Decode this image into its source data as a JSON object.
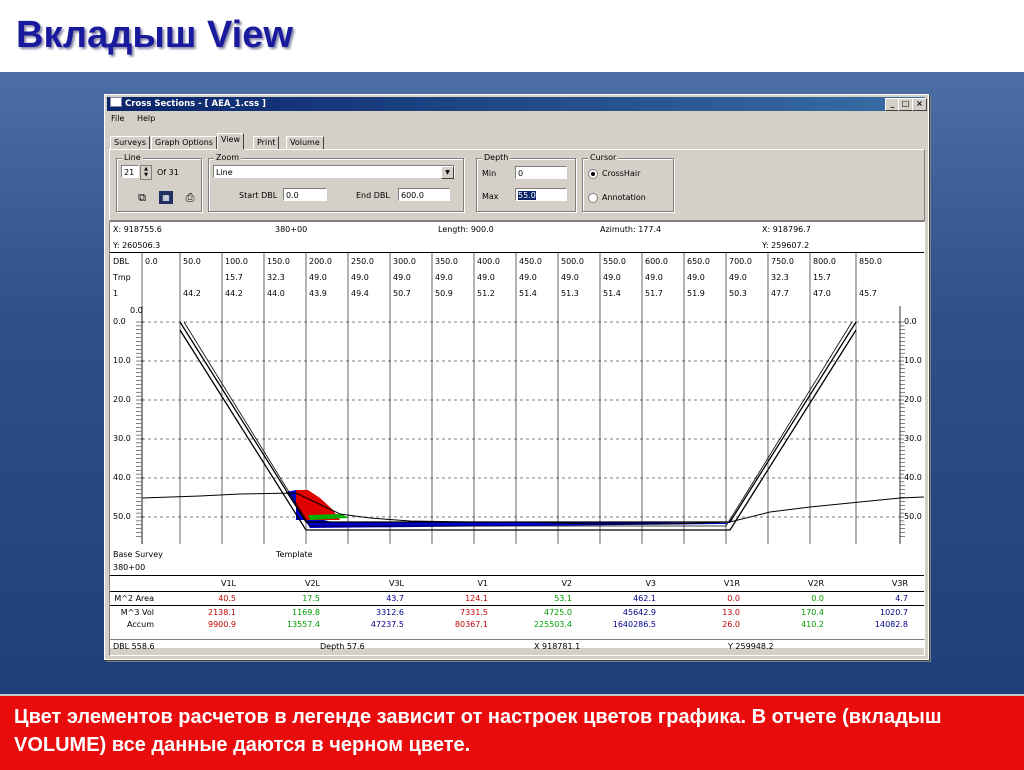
{
  "slide": {
    "title": "Вкладыш View",
    "caption": "Цвет элементов расчетов в легенде зависит от настроек цветов графика.  В отчете (вкладыш VOLUME) все данные даются в черном цвете."
  },
  "window": {
    "title": "Cross  Sections - [ AEA_1.css ]",
    "buttons": {
      "minimize": "_",
      "restore": "□",
      "close": "×"
    },
    "menu": [
      "File",
      "Help"
    ],
    "tabs": [
      "Surveys",
      "Graph Options",
      "View",
      "Print",
      "Volume"
    ],
    "active_tab": "View"
  },
  "controls": {
    "line": {
      "label": "Line",
      "value": "21",
      "of": "Of  31"
    },
    "zoom": {
      "label": "Zoom",
      "mode": "Line",
      "start_label": "Start DBL",
      "start_value": "0.0",
      "end_label": "End DBL",
      "end_value": "600.0"
    },
    "depth": {
      "label": "Depth",
      "min_label": "Min",
      "min_value": "0",
      "max_label": "Max",
      "max_value": "55.0"
    },
    "cursor": {
      "label": "Cursor",
      "options": [
        "CrossHair",
        "Annotation"
      ],
      "selected": "CrossHair"
    }
  },
  "plot": {
    "info": {
      "x_left": "X: 918755.6",
      "station": "380+00",
      "length": "Length: 900.0",
      "azimuth": "Azimuth: 177.4",
      "x_right": "X: 918796.7",
      "y_left": "Y: 260506.3",
      "y_right": "Y: 259607.2"
    },
    "row_labels": [
      "DBL",
      "Tmp",
      "1"
    ],
    "dbl": [
      "0.0",
      "50.0",
      "100.0",
      "150.0",
      "200.0",
      "250.0",
      "300.0",
      "350.0",
      "400.0",
      "450.0",
      "500.0",
      "550.0",
      "600.0",
      "650.0",
      "700.0",
      "750.0",
      "800.0",
      "850.0"
    ],
    "tmp": [
      "",
      "",
      "15.7",
      "32.3",
      "49.0",
      "49.0",
      "49.0",
      "49.0",
      "49.0",
      "49.0",
      "49.0",
      "49.0",
      "49.0",
      "49.0",
      "49.0",
      "32.3",
      "15.7",
      ""
    ],
    "survey": [
      "",
      "44.2",
      "44.2",
      "44.0",
      "43.9",
      "49.4",
      "50.7",
      "50.9",
      "51.2",
      "51.4",
      "51.3",
      "51.4",
      "51.7",
      "51.9",
      "50.3",
      "47.7",
      "47.0",
      "45.7"
    ],
    "origin_label": "0.0",
    "depth_ticks": [
      "0.0",
      "10.0",
      "20.0",
      "30.0",
      "40.0",
      "50.0"
    ],
    "base_survey_label": "Base Survey",
    "template_label": "Template",
    "station": "380+00"
  },
  "legend": {
    "headers": [
      "V1L",
      "V2L",
      "V3L",
      "V1",
      "V2",
      "V3",
      "V1R",
      "V2R",
      "V3R"
    ],
    "rows": [
      {
        "label": "M^2 Area",
        "values": [
          "40.5",
          "17.5",
          "43.7",
          "124.1",
          "53.1",
          "462.1",
          "0.0",
          "0.0",
          "4.7"
        ]
      },
      {
        "label": "M^3 Vol",
        "values": [
          "2138.1",
          "1169.8",
          "3312.6",
          "7331.5",
          "4725.0",
          "45642.9",
          "13.0",
          "170.4",
          "1020.7"
        ]
      },
      {
        "label": "Accum",
        "values": [
          "9900.9",
          "13557.4",
          "47237.5",
          "80367.1",
          "225503.4",
          "1640286.5",
          "26.0",
          "410.2",
          "14082.8"
        ]
      }
    ],
    "colors": [
      "#c00000",
      "#00a000",
      "#00008b",
      "#c00000",
      "#00a000",
      "#00008b",
      "#c00000",
      "#00a000",
      "#00008b"
    ]
  },
  "status": {
    "dbl": "DBL 558.6",
    "depth": "Depth 57.6",
    "x": "X 918781.1",
    "y": "Y 259948.2"
  },
  "colors": {
    "window_title": "#0a246a",
    "slide_title": "#1a1a9e",
    "caption_band": "#e80c0c",
    "fill_red": "#e00000",
    "fill_blue": "#0000cc",
    "fill_green": "#00b000"
  }
}
